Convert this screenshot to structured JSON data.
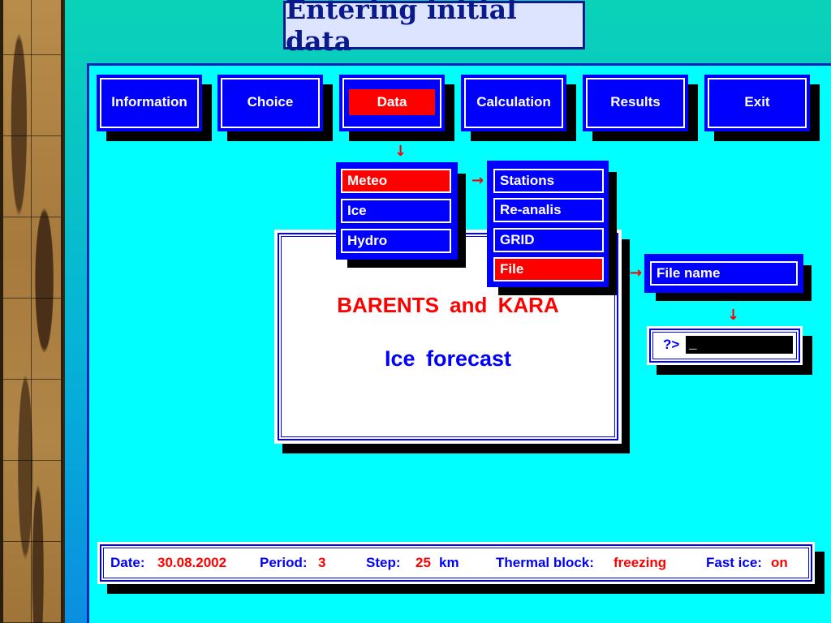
{
  "slide_title": "Entering initial data",
  "menu": [
    {
      "label": "Information"
    },
    {
      "label": "Choice"
    },
    {
      "label": "Data"
    },
    {
      "label": "Calculation"
    },
    {
      "label": "Results"
    },
    {
      "label": "Exit"
    }
  ],
  "data_submenu": [
    {
      "label": "Meteo"
    },
    {
      "label": "Ice"
    },
    {
      "label": "Hydro"
    }
  ],
  "meteo_submenu": [
    {
      "label": "Stations"
    },
    {
      "label": "Re-analis"
    },
    {
      "label": "GRID"
    },
    {
      "label": "File"
    }
  ],
  "file_name": {
    "label": "File name"
  },
  "prompt": {
    "label": "?>",
    "value": "_"
  },
  "splash": {
    "title": "BARENTS and KARA",
    "subtitle": "Ice forecast"
  },
  "status": {
    "date_label": "Date:",
    "date_value": "30.08.2002",
    "period_label": "Period:",
    "period_value": "3",
    "step_label": "Step:",
    "step_value": "25",
    "step_unit": "km",
    "thermal_label": "Thermal block:",
    "thermal_value": "freezing",
    "fastice_label": "Fast ice:",
    "fastice_value": "on"
  },
  "colors": {
    "menu_blue": "#0000ff",
    "highlight_red": "#ff0000",
    "screen_cyan": "#00ffff"
  }
}
